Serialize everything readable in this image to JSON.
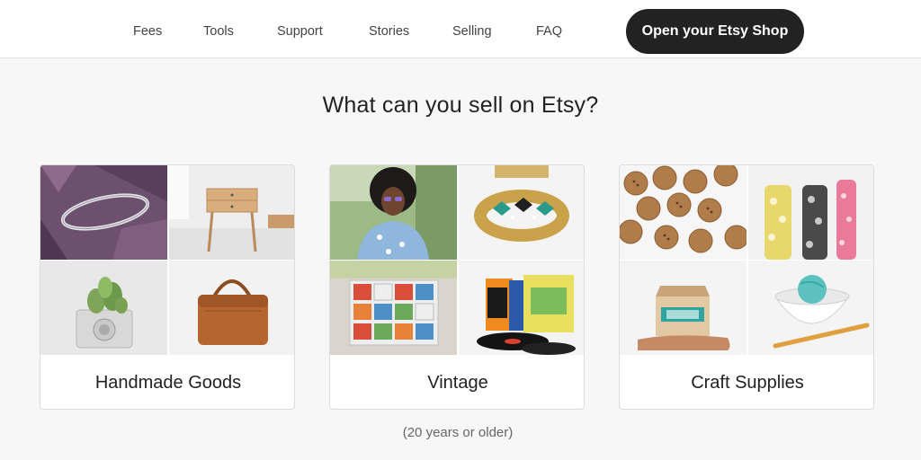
{
  "nav": {
    "links": [
      "Fees",
      "Tools",
      "Support",
      "Stories",
      "Selling",
      "FAQ"
    ],
    "cta_label": "Open your Etsy Shop"
  },
  "headline": "What can you sell on Etsy?",
  "categories": [
    {
      "label": "Handmade Goods",
      "images": [
        "silver-ring-photo",
        "wooden-nightstand-photo",
        "succulent-camera-planter-photo",
        "leather-bag-photo"
      ]
    },
    {
      "label": "Vintage",
      "images": [
        "vintage-fashion-portrait-photo",
        "jeweled-bracelet-photo",
        "retro-locker-cabinet-photo",
        "vinyl-records-photo"
      ]
    },
    {
      "label": "Craft Supplies",
      "images": [
        "wooden-buttons-photo",
        "fabric-rolls-photo",
        "craft-kit-box-photo",
        "yarn-bowl-photo"
      ]
    }
  ],
  "vintage_note": "(20 years or older)",
  "colors": {
    "cta_background": "#222222",
    "page_background": "#f7f7f7",
    "nav_background": "#ffffff"
  }
}
